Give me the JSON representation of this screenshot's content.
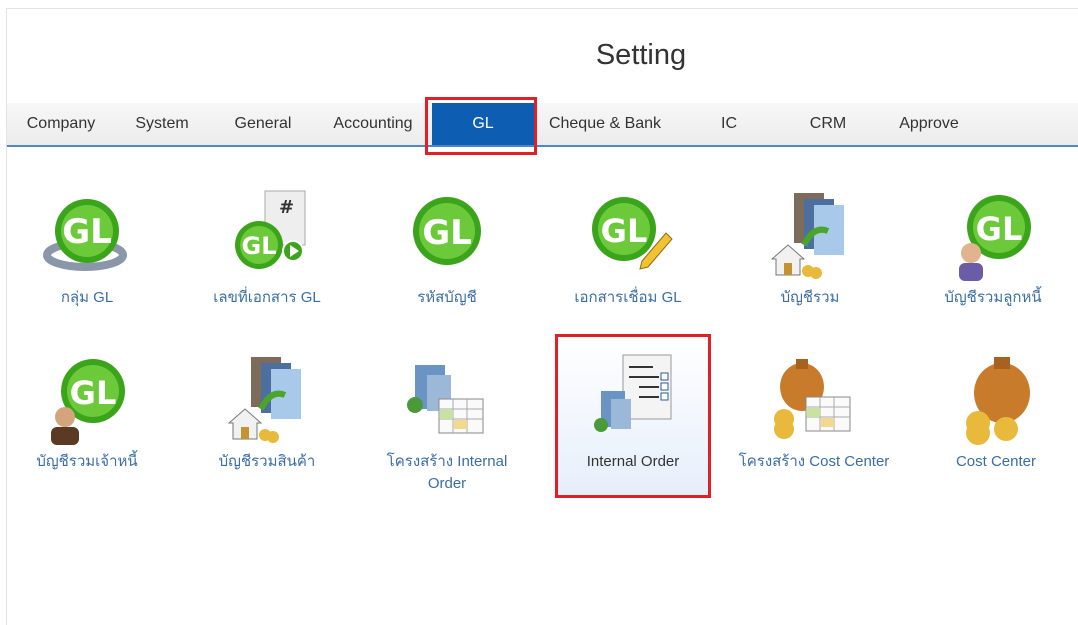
{
  "page": {
    "title": "Setting"
  },
  "tabs": [
    {
      "label": "Company"
    },
    {
      "label": "System"
    },
    {
      "label": "General"
    },
    {
      "label": "Accounting"
    },
    {
      "label": "GL",
      "active": true
    },
    {
      "label": "Cheque & Bank"
    },
    {
      "label": "IC"
    },
    {
      "label": "CRM"
    },
    {
      "label": "Approve"
    }
  ],
  "tiles": [
    {
      "label": "กลุ่ม GL",
      "icon": "gl-group-icon"
    },
    {
      "label": "เลขที่เอกสาร GL",
      "icon": "gl-document-number-icon"
    },
    {
      "label": "รหัสบัญชี",
      "icon": "gl-account-code-icon"
    },
    {
      "label": "เอกสารเชื่อม GL",
      "icon": "gl-link-document-icon"
    },
    {
      "label": "บัญชีรวม",
      "icon": "control-account-icon"
    },
    {
      "label": "บัญชีรวมลูกหนี้",
      "icon": "ar-control-account-icon"
    },
    {
      "label": "บัญชีรวมเจ้าหนี้",
      "icon": "ap-control-account-icon"
    },
    {
      "label": "บัญชีรวมสินค้า",
      "icon": "inventory-control-account-icon"
    },
    {
      "label": "โครงสร้าง Internal Order",
      "icon": "internal-order-structure-icon"
    },
    {
      "label": "Internal Order",
      "icon": "internal-order-icon",
      "selected": true
    },
    {
      "label": "โครงสร้าง Cost Center",
      "icon": "cost-center-structure-icon"
    },
    {
      "label": "Cost Center",
      "icon": "cost-center-icon"
    }
  ],
  "colors": {
    "tab_active": "#0d5eb2",
    "highlight": "#e01f26",
    "label": "#3a6ea5",
    "gl_green": "#3aa41b"
  }
}
